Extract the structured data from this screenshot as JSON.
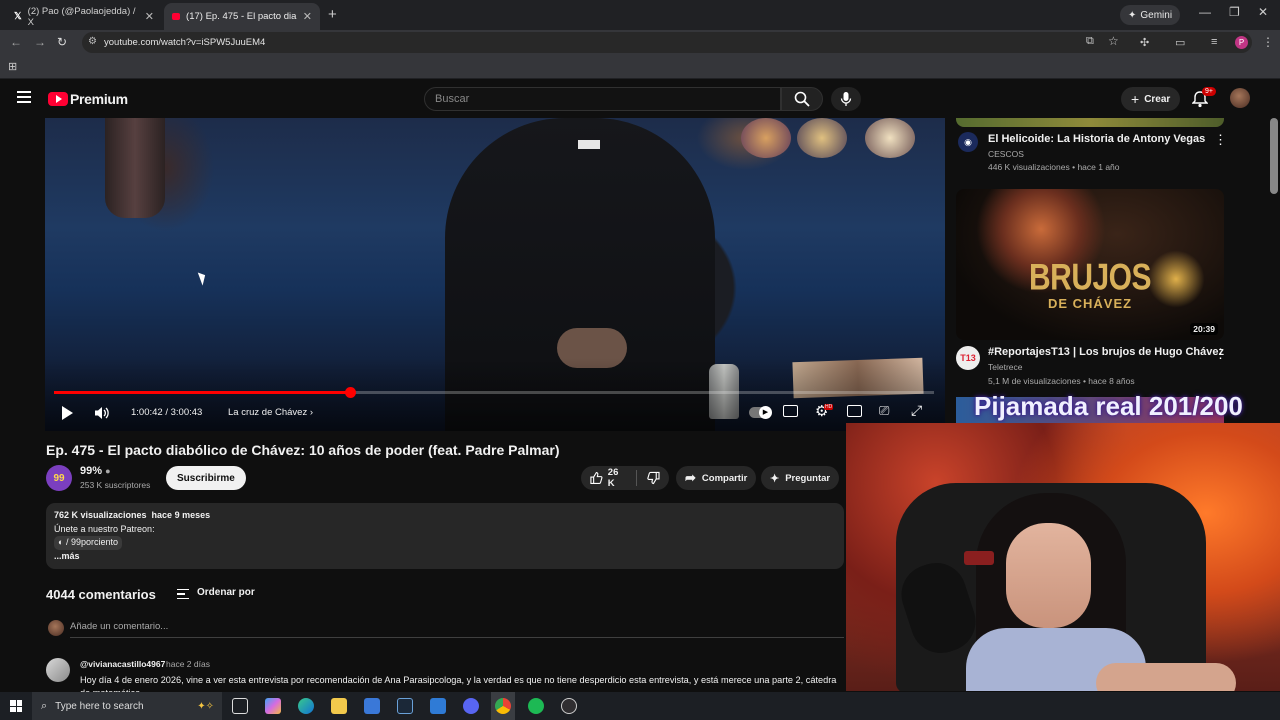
{
  "browser": {
    "tabs": [
      {
        "label": "(2) Pao (@Paolaojedda) / X",
        "icon": "x-logo-icon"
      },
      {
        "label": "(17) Ep. 475 - El pacto diabólic...",
        "icon": "youtube-icon"
      }
    ],
    "gemini_label": "Gemini",
    "url": "youtube.com/watch?v=iSPW5JuuEM4"
  },
  "youtube": {
    "brand": "Premium",
    "search_placeholder": "Buscar",
    "create_label": "Crear",
    "notif_badge": "9+"
  },
  "player": {
    "time_current": "1:00:42",
    "time_total": "3:00:43",
    "time_text": "1:00:42 / 3:00:43",
    "chapter": "La cruz de Chávez",
    "progress_fraction": 0.336
  },
  "video": {
    "title": "Ep. 475 - El pacto diabólico de Chávez: 10 años de poder (feat. Padre Palmar)",
    "channel_name": "99%",
    "channel_avatar_text": "99",
    "subscribers": "253 K suscriptores",
    "subscribe_label": "Suscribirme",
    "likes": "26 K",
    "share_label": "Compartir",
    "ask_label": "Preguntar"
  },
  "description": {
    "stats": "762 K visualizaciones  hace 9 meses",
    "line1": "Únete a nuestro Patreon:",
    "patreon": "/ 99porciento",
    "more": "...más"
  },
  "comments": {
    "count": "4044 comentarios",
    "sort_label": "Ordenar por",
    "add_placeholder": "Añade un comentario...",
    "first": {
      "user": "@vivianacastillo4967",
      "time": "hace 2 días",
      "text": "Hoy día 4 de enero 2026, vine a ver esta entrevista por recomendación de  Ana Parasipcologa, y la verdad es que no tiene desperdicio esta entrevista, y está merece una parte 2, cátedra de matemática..."
    }
  },
  "sidebar": {
    "rec1": {
      "title": "El Helicoide: La Historia de Antony Vegas",
      "channel": "CESCOS",
      "meta": "446 K visualizaciones • hace 1 año"
    },
    "rec2": {
      "thumb_text": "BRUJOS",
      "thumb_subtext": "DE CHÁVEZ",
      "duration": "20:39",
      "title": "#ReportajesT13 | Los brujos de Hugo Chávez",
      "channel": "Teletrece",
      "channel_avatar_text": "T13",
      "meta": "5,1 M de visualizaciones • hace 8 años"
    }
  },
  "stream_overlay": "Pijamada real 201/200",
  "taskbar": {
    "search_placeholder": "Type here to search",
    "apps": [
      "task-view-icon",
      "copilot-icon",
      "edge-icon",
      "file-explorer-icon",
      "store-icon",
      "steam-icon",
      "mail-icon",
      "discord-icon",
      "chrome-icon",
      "spotify-icon",
      "obs-icon"
    ]
  },
  "colors": {
    "youtube_red": "#ff0033",
    "progress": "#ff0000",
    "background": "#0f0f0f"
  }
}
